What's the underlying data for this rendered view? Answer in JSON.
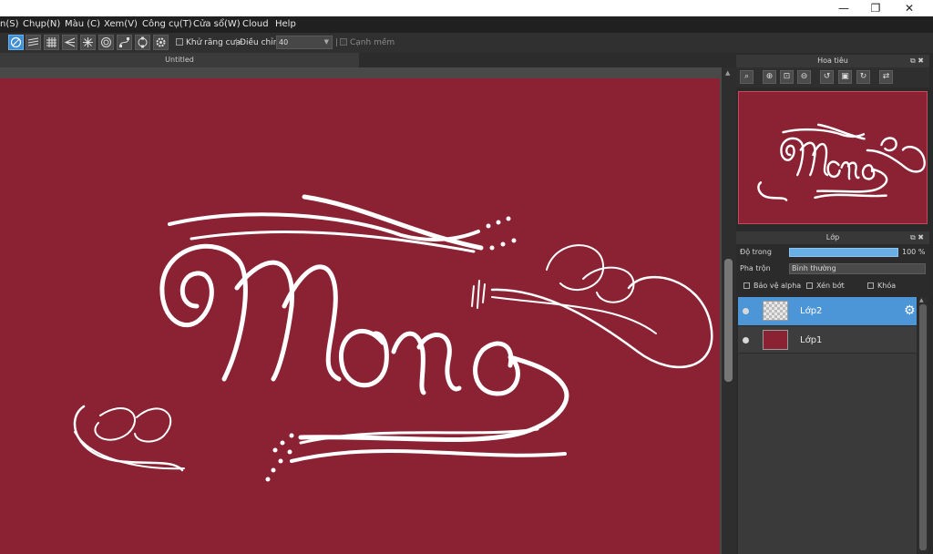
{
  "window": {
    "minimize_glyph": "—",
    "restore_glyph": "❐",
    "close_glyph": "✕"
  },
  "menubar": {
    "items": [
      "n(S)",
      "Chụp(N)",
      "Màu (C)",
      "Xem(V)",
      "Công cụ(T)",
      "Cửa sổ(W)",
      "Cloud",
      "Help"
    ]
  },
  "toolbar": {
    "antialias_label": "Khử răng cưa",
    "adjust_label": "Điều chỉnh",
    "adjust_value": "40",
    "soft_edge_label": "Cạnh mềm",
    "antialias_checked": true
  },
  "document": {
    "tab_title": "Untitled",
    "canvas_color": "#8a2233"
  },
  "navigator": {
    "title": "Hoa tiêu",
    "buttons": [
      "⌕",
      "⊕",
      "⊡",
      "⊖",
      "↺",
      "▣",
      "↻",
      "⇄"
    ]
  },
  "layers": {
    "title": "Lớp",
    "opacity_label": "Độ trong",
    "opacity_value": "100 %",
    "opacity_fraction": 1.0,
    "blend_label": "Pha trộn",
    "blend_value": "Bình thường",
    "protect_alpha_label": "Bảo vệ alpha",
    "clipping_label": "Xén bớt",
    "lock_label": "Khóa",
    "items": [
      {
        "name": "Lớp2",
        "selected": true,
        "thumb": "transparent"
      },
      {
        "name": "Lớp1",
        "selected": false,
        "thumb": "#8a2233"
      }
    ],
    "selected_color": "#4c95d6",
    "gear_glyph": "⚙"
  },
  "panel_icons": {
    "float_glyph": "⧉",
    "close_glyph": "✖"
  }
}
